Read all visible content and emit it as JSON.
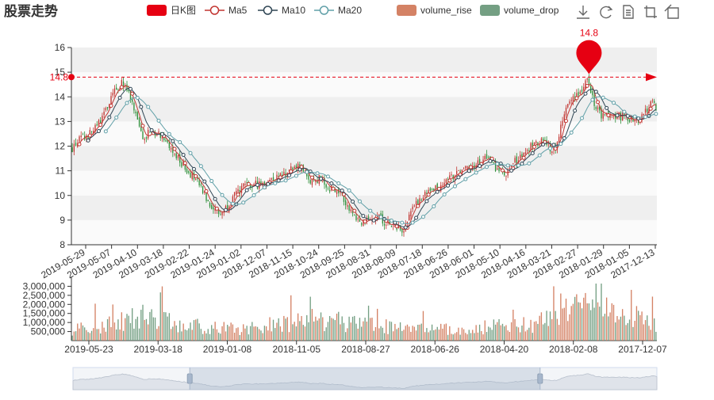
{
  "title": "股票走势",
  "legend": {
    "items": [
      {
        "key": "kline",
        "label": "日K图",
        "color": "#e60012",
        "type": "rect"
      },
      {
        "key": "ma5",
        "label": "Ma5",
        "color": "#c23531",
        "type": "line"
      },
      {
        "key": "ma10",
        "label": "Ma10",
        "color": "#2f4554",
        "type": "line"
      },
      {
        "key": "ma20",
        "label": "Ma20",
        "color": "#61a0a8",
        "type": "line"
      },
      {
        "key": "volume_rise",
        "label": "volume_rise",
        "color": "#d48265",
        "type": "rect"
      },
      {
        "key": "volume_drop",
        "label": "volume_drop",
        "color": "#749f83",
        "type": "rect"
      }
    ]
  },
  "toolbox": {
    "icons": [
      "download-icon",
      "refresh-icon",
      "data-view-icon",
      "zoom-icon",
      "zoom-reset-icon"
    ]
  },
  "colors": {
    "rise": "#c23531",
    "drop": "#2f8f3a",
    "vol_rise": "#d48265",
    "vol_drop": "#749f83",
    "ma5": "#c23531",
    "ma10": "#2f4554",
    "ma20": "#61a0a8",
    "markline": "#e60012",
    "band": "#efefef"
  },
  "chart_data": [
    {
      "type": "candlestick",
      "ylim": [
        8,
        16
      ],
      "yticks": [
        8,
        9,
        10,
        11,
        12,
        13,
        14,
        15,
        16
      ],
      "x_tick_labels": [
        "2019-05-29",
        "2019-05-07",
        "2019-04-10",
        "2019-03-18",
        "2019-02-22",
        "2019-01-24",
        "2019-01-02",
        "2018-12-07",
        "2018-11-15",
        "2018-10-24",
        "2018-09-25",
        "2018-08-31",
        "2018-08-09",
        "2018-07-18",
        "2018-06-26",
        "2018-06-01",
        "2018-05-10",
        "2018-04-16",
        "2018-03-21",
        "2018-02-27",
        "2018-01-29",
        "2018-01-05",
        "2017-12-13"
      ],
      "markpoint": {
        "label": "14.8",
        "value": 14.8
      },
      "markline": {
        "label": "14.8",
        "value": 14.8
      },
      "price_anchors": [
        [
          0,
          11.9
        ],
        [
          3,
          12.2
        ],
        [
          8,
          12.4
        ],
        [
          12,
          12.6
        ],
        [
          18,
          13.3
        ],
        [
          24,
          14.2
        ],
        [
          28,
          14.6
        ],
        [
          32,
          14.1
        ],
        [
          36,
          13.2
        ],
        [
          40,
          12.4
        ],
        [
          46,
          12.6
        ],
        [
          52,
          12.4
        ],
        [
          56,
          11.8
        ],
        [
          62,
          11.3
        ],
        [
          66,
          11.0
        ],
        [
          72,
          10.4
        ],
        [
          76,
          9.9
        ],
        [
          80,
          9.5
        ],
        [
          84,
          9.25
        ],
        [
          90,
          9.8
        ],
        [
          96,
          10.3
        ],
        [
          102,
          10.4
        ],
        [
          108,
          10.5
        ],
        [
          114,
          10.7
        ],
        [
          120,
          10.9
        ],
        [
          126,
          11.1
        ],
        [
          130,
          11.2
        ],
        [
          134,
          10.5
        ],
        [
          140,
          10.7
        ],
        [
          146,
          10.3
        ],
        [
          152,
          10.2
        ],
        [
          156,
          9.6
        ],
        [
          162,
          9.0
        ],
        [
          166,
          8.9
        ],
        [
          172,
          9.2
        ],
        [
          178,
          8.9
        ],
        [
          184,
          8.7
        ],
        [
          188,
          8.6
        ],
        [
          192,
          9.4
        ],
        [
          198,
          9.9
        ],
        [
          204,
          10.2
        ],
        [
          210,
          10.5
        ],
        [
          216,
          10.8
        ],
        [
          222,
          11.0
        ],
        [
          228,
          11.2
        ],
        [
          234,
          11.5
        ],
        [
          238,
          11.3
        ],
        [
          242,
          11.0
        ],
        [
          246,
          10.8
        ],
        [
          250,
          11.3
        ],
        [
          256,
          11.7
        ],
        [
          262,
          12.1
        ],
        [
          266,
          12.2
        ],
        [
          270,
          11.9
        ],
        [
          274,
          12.0
        ],
        [
          280,
          13.6
        ],
        [
          284,
          14.0
        ],
        [
          288,
          14.2
        ],
        [
          292,
          14.8
        ],
        [
          296,
          13.8
        ],
        [
          300,
          13.2
        ],
        [
          306,
          13.3
        ],
        [
          312,
          13.2
        ],
        [
          318,
          13.0
        ],
        [
          324,
          13.2
        ],
        [
          328,
          13.8
        ],
        [
          331,
          13.6
        ]
      ]
    },
    {
      "type": "bar",
      "ylim": [
        0,
        3500000
      ],
      "yticks": [
        500000,
        1000000,
        1500000,
        2000000,
        2500000,
        3000000
      ],
      "ytick_labels": [
        "500,000",
        "1,000,000",
        "1,500,000",
        "2,000,000",
        "2,500,000",
        "3,000,000"
      ],
      "x_tick_labels": [
        "2019-05-23",
        "2019-03-18",
        "2019-01-08",
        "2018-11-05",
        "2018-08-27",
        "2018-06-26",
        "2018-04-20",
        "2018-02-08",
        "2017-12-07"
      ],
      "volume_anchors": [
        [
          0,
          600000
        ],
        [
          20,
          900000
        ],
        [
          40,
          1400000
        ],
        [
          60,
          900000
        ],
        [
          80,
          700000
        ],
        [
          100,
          650000
        ],
        [
          120,
          1000000
        ],
        [
          140,
          1200000
        ],
        [
          160,
          900000
        ],
        [
          180,
          750000
        ],
        [
          200,
          600000
        ],
        [
          220,
          650000
        ],
        [
          240,
          800000
        ],
        [
          260,
          900000
        ],
        [
          280,
          1900000
        ],
        [
          300,
          1600000
        ],
        [
          320,
          1300000
        ],
        [
          331,
          1000000
        ]
      ]
    }
  ],
  "datazoom": {
    "start": 0.2,
    "end": 0.8
  }
}
